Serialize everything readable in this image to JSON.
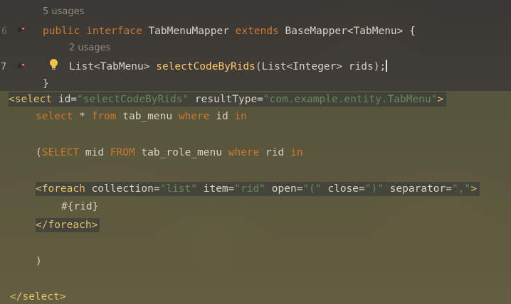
{
  "java": {
    "usages1": "5 usages",
    "line6_num": "6",
    "line6": {
      "kw1": "public",
      "kw2": "interface",
      "name": "TabMenuMapper",
      "kw3": "extends",
      "base": "BaseMapper<TabMenu> {"
    },
    "usages2": "2 usages",
    "line7_num": "7",
    "line7": {
      "ret": "List<TabMenu> ",
      "method": "selectCodeByRids",
      "params": "(List<Integer> rids);"
    },
    "close_brace": "}"
  },
  "xml": {
    "select_open": {
      "lt": "<select",
      "id_attr": " id=",
      "id_val": "\"selectCodeByRids\"",
      "rt_attr": " resultType=",
      "rt_val": "\"com.example.entity.TabMenu\"",
      "gt": ">"
    },
    "sql1": {
      "select": "select",
      "star": " * ",
      "from": "from",
      "table": " tab_menu ",
      "where": "where",
      "id": " id ",
      "in": "in"
    },
    "sql2": {
      "paren": "(",
      "select": "SELECT",
      "mid": " mid ",
      "from": "FROM",
      "table": " tab_role_menu ",
      "where": "where",
      "rid": " rid ",
      "in": "in"
    },
    "foreach_open": {
      "lt": "<foreach",
      "coll_attr": " collection=",
      "coll_val": "\"list\"",
      "item_attr": " item=",
      "item_val": "\"rid\"",
      "open_attr": " open=",
      "open_val": "\"(\"",
      "close_attr": " close=",
      "close_val": "\")\"",
      "sep_attr": " separator=",
      "sep_val": "\",\"",
      "gt": ">"
    },
    "param": "#{rid}",
    "foreach_close": "</foreach>",
    "paren_close": ")",
    "select_close": "</select>"
  },
  "colors": {
    "keyword": "#cc7832",
    "method": "#ffc66d",
    "xml_tag": "#e8bf6a",
    "attr_value": "#6a8759",
    "text": "#d9d2c5"
  },
  "icons": [
    "mapper-bird-icon",
    "lightbulb-icon"
  ]
}
